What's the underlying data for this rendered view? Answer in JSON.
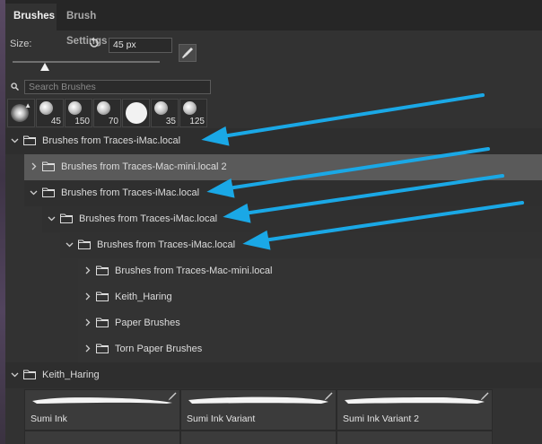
{
  "tabs": {
    "active": "Brushes",
    "inactive": "Brush Settings"
  },
  "size": {
    "label": "Size:",
    "value": "45 px"
  },
  "search": {
    "placeholder": "Search Brushes"
  },
  "presets": [
    "",
    "45",
    "150",
    "70",
    "",
    "35",
    "125"
  ],
  "tree": [
    {
      "name": "Brushes from Traces-iMac.local",
      "expanded": true
    },
    {
      "name": "Brushes from Traces-Mac-mini.local 2",
      "expanded": false
    },
    {
      "name": "Brushes from Traces-iMac.local",
      "expanded": true
    },
    {
      "name": "Brushes from Traces-iMac.local",
      "expanded": true
    },
    {
      "name": "Brushes from Traces-iMac.local",
      "expanded": true
    },
    {
      "name": "Brushes from Traces-Mac-mini.local",
      "expanded": false
    },
    {
      "name": "Keith_Haring",
      "expanded": false
    },
    {
      "name": "Paper Brushes",
      "expanded": false
    },
    {
      "name": "Torn Paper Brushes",
      "expanded": false
    },
    {
      "name": "Keith_Haring",
      "expanded": true
    }
  ],
  "tiles": [
    "Sumi Ink",
    "Sumi Ink Variant",
    "Sumi Ink Variant 2"
  ],
  "colors": {
    "panel": "#323232",
    "row_highlight": "#5a5a5a",
    "arrow": "#1aa8e6"
  },
  "icons": {
    "folder": "folder-icon",
    "chevron": "chevron-icon",
    "reset": "reset-icon",
    "search": "search-icon",
    "brush_tool": "brush-tool-icon"
  }
}
